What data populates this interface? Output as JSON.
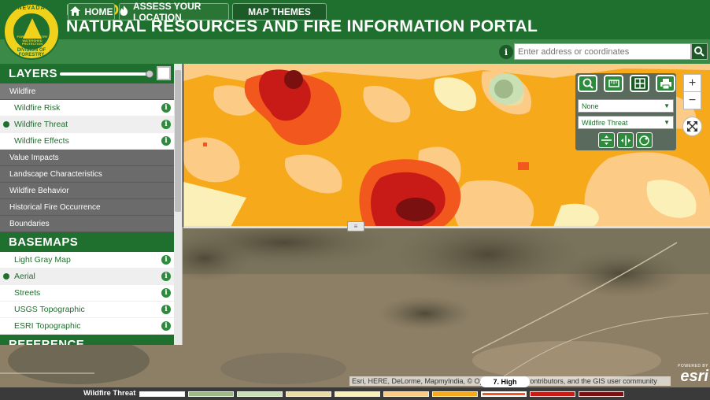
{
  "header": {
    "state": "NEVADA",
    "title": "NATURAL RESOURCES AND FIRE INFORMATION PORTAL",
    "logo": {
      "ring_top": "NEVADA",
      "ring_bottom": "DIVISION OF FORESTRY",
      "center_text": "FOREST FORESTRY WATERSHED PROTECTION"
    }
  },
  "nav": {
    "home": "HOME",
    "assess": "ASSESS YOUR LOCATION",
    "themes": "MAP THEMES",
    "search_placeholder": "Enter address or coordinates",
    "icons": {
      "home": "home-icon",
      "assess": "fire-icon",
      "info": "info-icon",
      "search": "search-icon"
    }
  },
  "layers": {
    "title": "LAYERS",
    "opacity": 0.92,
    "wildfire_group": "Wildfire",
    "wildfire_items": [
      {
        "label": "Wildfire Risk",
        "active": false
      },
      {
        "label": "Wildfire Threat",
        "active": true
      },
      {
        "label": "Wildfire Effects",
        "active": false
      }
    ],
    "groups": [
      "Value Impacts",
      "Landscape Characteristics",
      "Wildfire Behavior",
      "Historical Fire Occurrence",
      "Boundaries"
    ]
  },
  "basemaps": {
    "title": "BASEMAPS",
    "items": [
      {
        "label": "Light Gray Map",
        "active": false
      },
      {
        "label": "Aerial",
        "active": true
      },
      {
        "label": "Streets",
        "active": false
      },
      {
        "label": "USGS Topographic",
        "active": false
      },
      {
        "label": "ESRI Topographic",
        "active": false
      }
    ],
    "next_title": "REFERENCE"
  },
  "map_tools": {
    "select1": "None",
    "select2": "Wildfire Threat",
    "buttons": [
      "zoom-search-icon",
      "measure-icon",
      "swipe-icon",
      "print-icon"
    ],
    "small_buttons": [
      "swipe-horizontal-icon",
      "swipe-vertical-icon",
      "spyglass-icon"
    ],
    "zoom_in": "+",
    "zoom_out": "−"
  },
  "attribution": "Esri, HERE, DeLorme, MapmyIndia, © OpenStreetMap contributors, and the GIS user community",
  "esri": {
    "powered": "POWERED BY",
    "brand": "esri"
  },
  "legend": {
    "label": "Wildfire Threat",
    "selected_label": "7. High",
    "selected_index": 7,
    "colors": [
      "#ffffff",
      "#9fb98a",
      "#c9dfb4",
      "#e9dca5",
      "#fbf0b8",
      "#fccb85",
      "#f7a91c",
      "#f2571e",
      "#c81a17",
      "#7a1010"
    ]
  }
}
